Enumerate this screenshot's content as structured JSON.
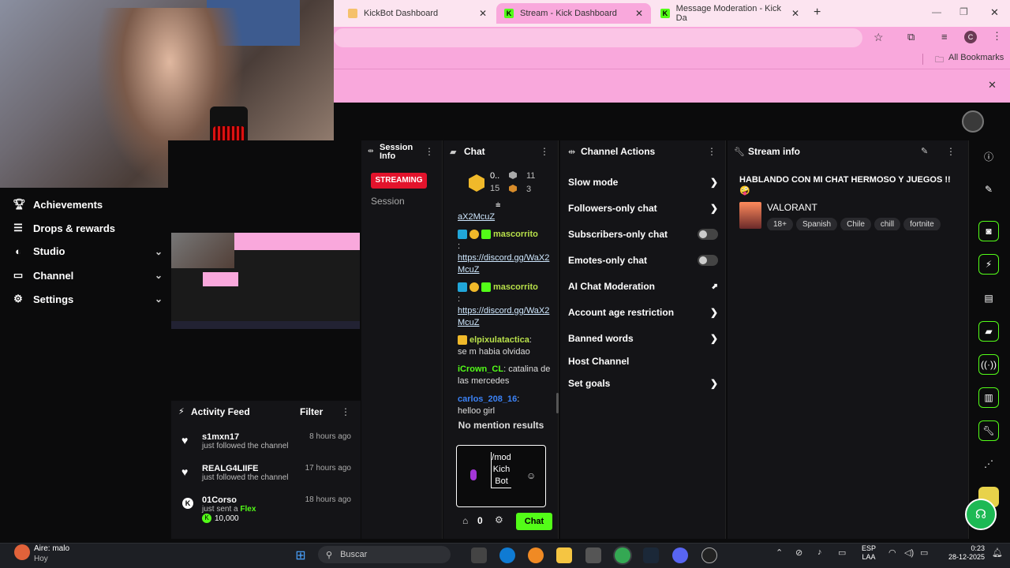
{
  "browser": {
    "tabs": [
      {
        "label": "KickBot Dashboard",
        "active": false
      },
      {
        "label": "Stream - Kick Dashboard",
        "active": true
      },
      {
        "label": "Message Moderation - Kick Da",
        "active": false
      }
    ],
    "bookmarks_label": "All Bookmarks",
    "profile_initial": "C"
  },
  "sidebar": {
    "items": [
      {
        "label": "Achievements",
        "icon": "trophy-icon"
      },
      {
        "label": "Drops & rewards",
        "icon": "drops-icon"
      },
      {
        "label": "Studio",
        "icon": "studio-icon"
      },
      {
        "label": "Channel",
        "icon": "channel-icon"
      },
      {
        "label": "Settings",
        "icon": "gear-icon"
      }
    ]
  },
  "session": {
    "title": "Session Info",
    "status": "STREAMING",
    "tab": "Session"
  },
  "activity": {
    "title": "Activity Feed",
    "filter": "Filter",
    "items": [
      {
        "name": "s1mxn17",
        "sub": "just followed the channel",
        "time": "8 hours ago"
      },
      {
        "name": "REALG4LIIFE",
        "sub": "just followed the channel",
        "time": "17 hours ago"
      },
      {
        "name": "01Corso",
        "sub_prefix": "just sent a",
        "sub_highlight": "Flex",
        "amount": "10,000",
        "time": "18 hours ago"
      }
    ]
  },
  "chat": {
    "title": "Chat",
    "stats": {
      "a": "0..",
      "b": "15",
      "c": "11",
      "d": "3"
    },
    "top_fragment": "aX2McuZ",
    "messages": [
      {
        "user": "mascorrito",
        "color": "#b8e04a",
        "text": ":",
        "link": "https://discord.gg/WaX2McuZ"
      },
      {
        "user": "mascorrito",
        "color": "#b8e04a",
        "text": ":",
        "link": "https://discord.gg/WaX2McuZ"
      },
      {
        "user": "elpixulatactica",
        "color": "#b8e04a",
        "text": "se m habia olvidao"
      },
      {
        "user": "iCrown_CL",
        "color": "#53fc18",
        "text": "catalina de las mercedes"
      },
      {
        "user": "carlos_208_16",
        "color": "#3b82f6",
        "text": "helloo girl"
      }
    ],
    "no_mention": "No mention results",
    "input_value": "/mod KichBot",
    "points": "0",
    "send_label": "Chat"
  },
  "channel_actions": {
    "title": "Channel Actions",
    "items": [
      {
        "label": "Slow mode",
        "control": "arrow"
      },
      {
        "label": "Followers-only chat",
        "control": "arrow"
      },
      {
        "label": "Subscribers-only chat",
        "control": "toggle"
      },
      {
        "label": "Emotes-only chat",
        "control": "toggle"
      },
      {
        "label": "AI Chat Moderation",
        "control": "chart"
      },
      {
        "label": "Account age restriction",
        "control": "arrow"
      },
      {
        "label": "Banned words",
        "control": "arrow"
      },
      {
        "label": "Host Channel",
        "control": "none"
      },
      {
        "label": "Set goals",
        "control": "arrow"
      }
    ]
  },
  "stream_info": {
    "title": "Stream info",
    "stream_title": "HABLANDO CON MI CHAT HERMOSO Y JUEGOS !! 🤪",
    "category": "VALORANT",
    "tags": [
      "18+",
      "Spanish",
      "Chile",
      "chill",
      "fortnite"
    ]
  },
  "taskbar": {
    "weather_title": "Aire: malo",
    "weather_sub": "Hoy",
    "search": "Buscar",
    "lang_1": "ESP",
    "lang_2": "LAA",
    "time": "0:23",
    "date": "28-12-2025"
  },
  "colors": {
    "accent": "#53fc18",
    "pink": "#f9a8dc",
    "streaming": "#e3132c"
  }
}
